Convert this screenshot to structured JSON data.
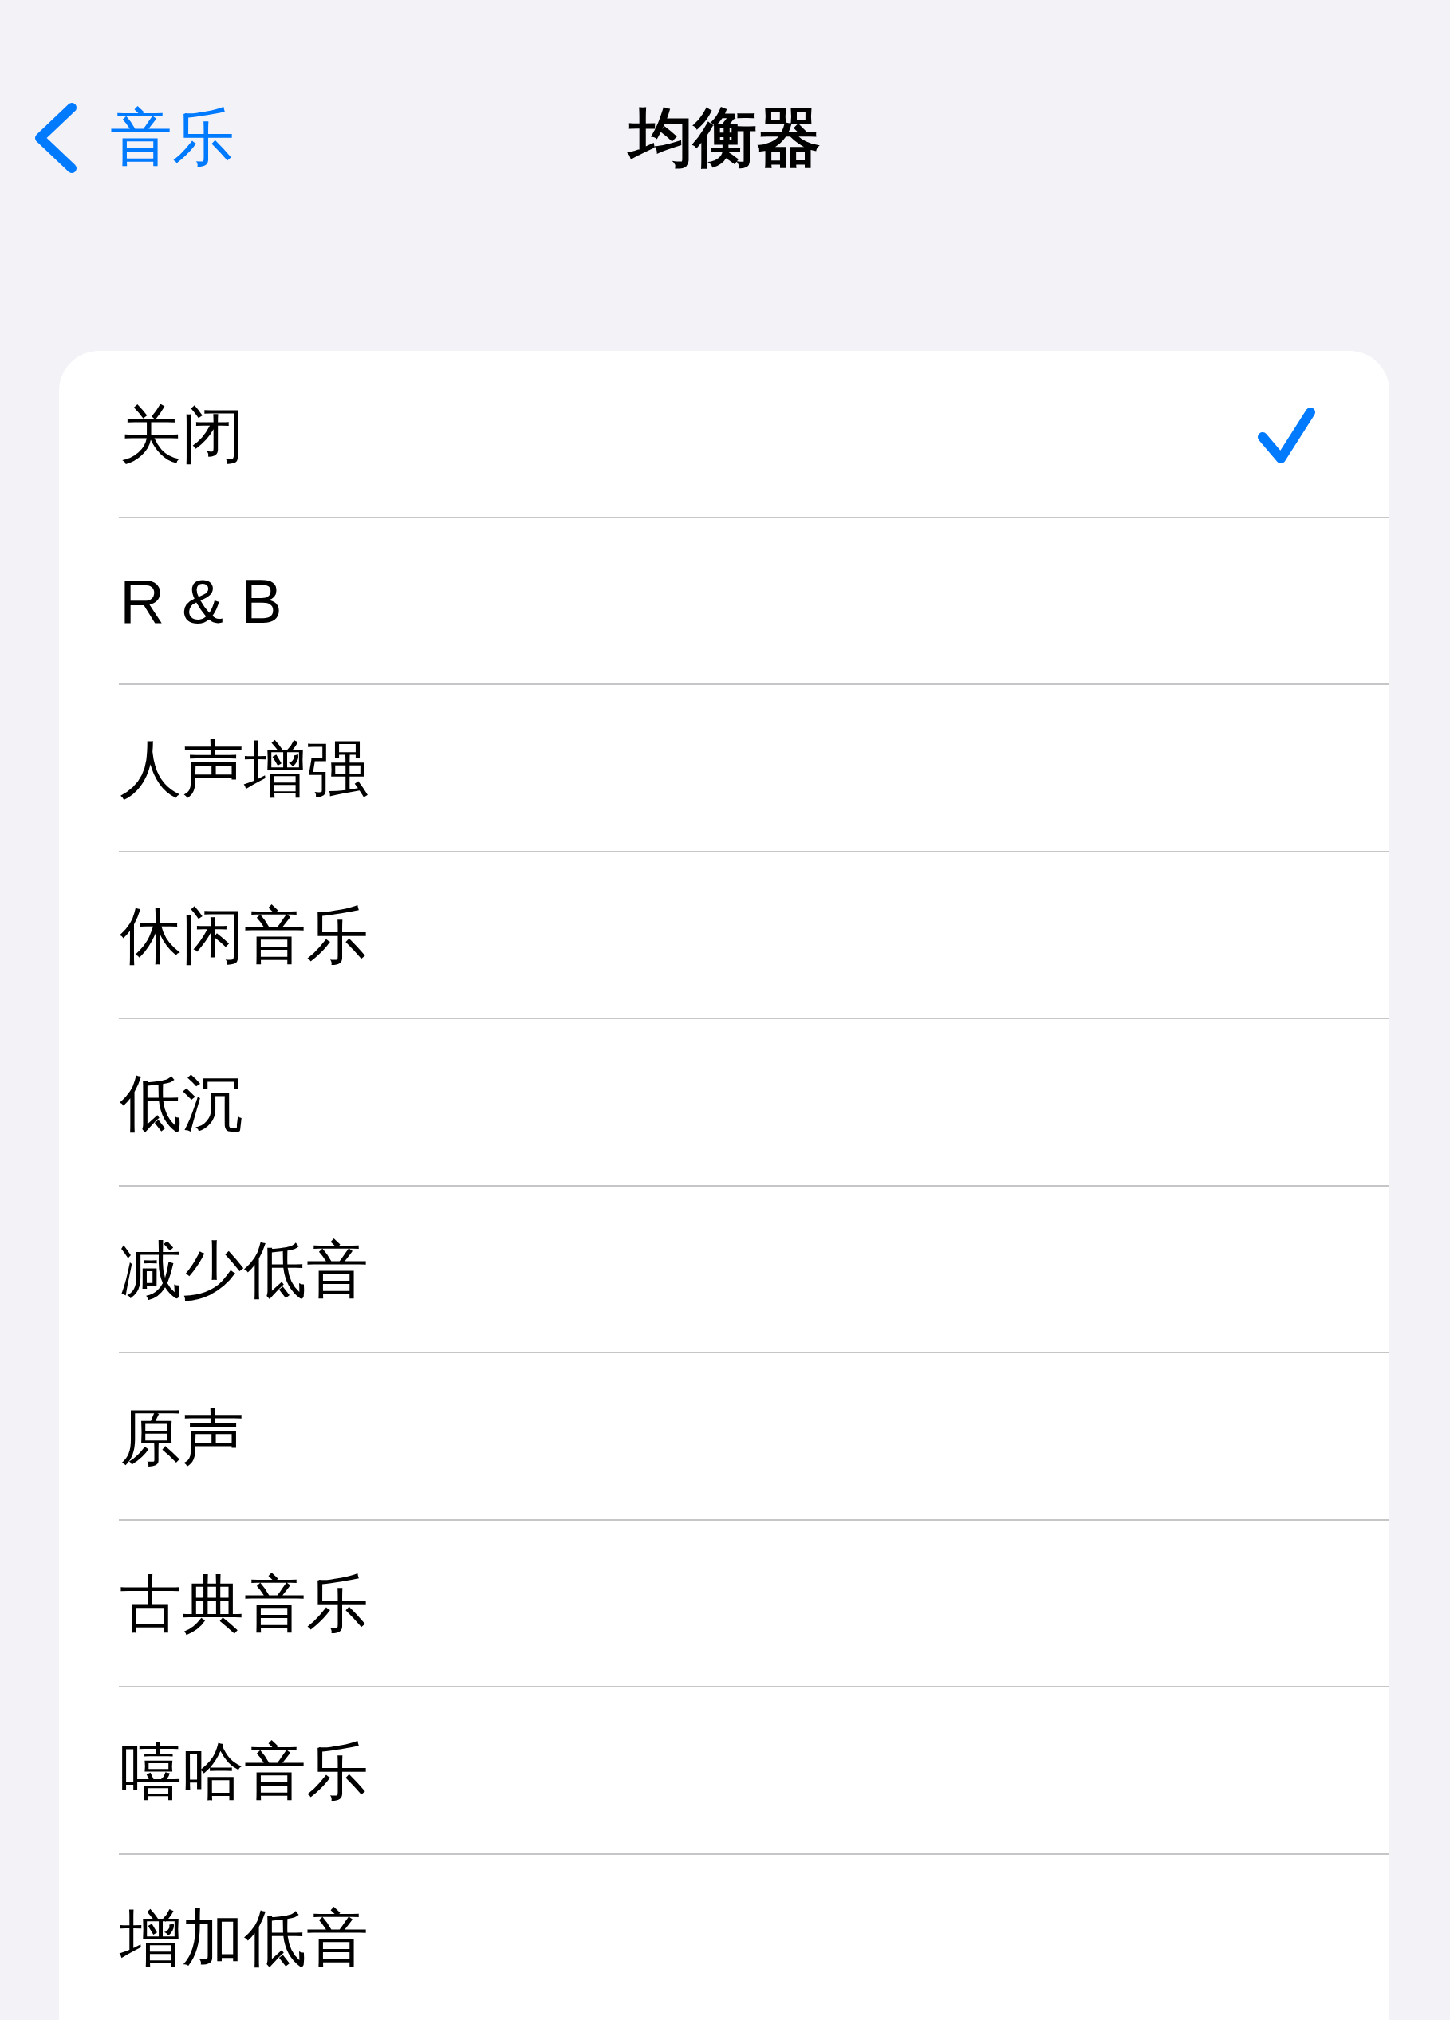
{
  "nav_bar": {
    "back_label": "音乐",
    "title": "均衡器"
  },
  "presets": [
    {
      "label": "关闭",
      "selected": true
    },
    {
      "label": "R & B",
      "selected": false
    },
    {
      "label": "人声增强",
      "selected": false
    },
    {
      "label": "休闲音乐",
      "selected": false
    },
    {
      "label": "低沉",
      "selected": false
    },
    {
      "label": "减少低音",
      "selected": false
    },
    {
      "label": "原声",
      "selected": false
    },
    {
      "label": "古典音乐",
      "selected": false
    },
    {
      "label": "嘻哈音乐",
      "selected": false
    },
    {
      "label": "增加低音",
      "selected": false
    }
  ]
}
